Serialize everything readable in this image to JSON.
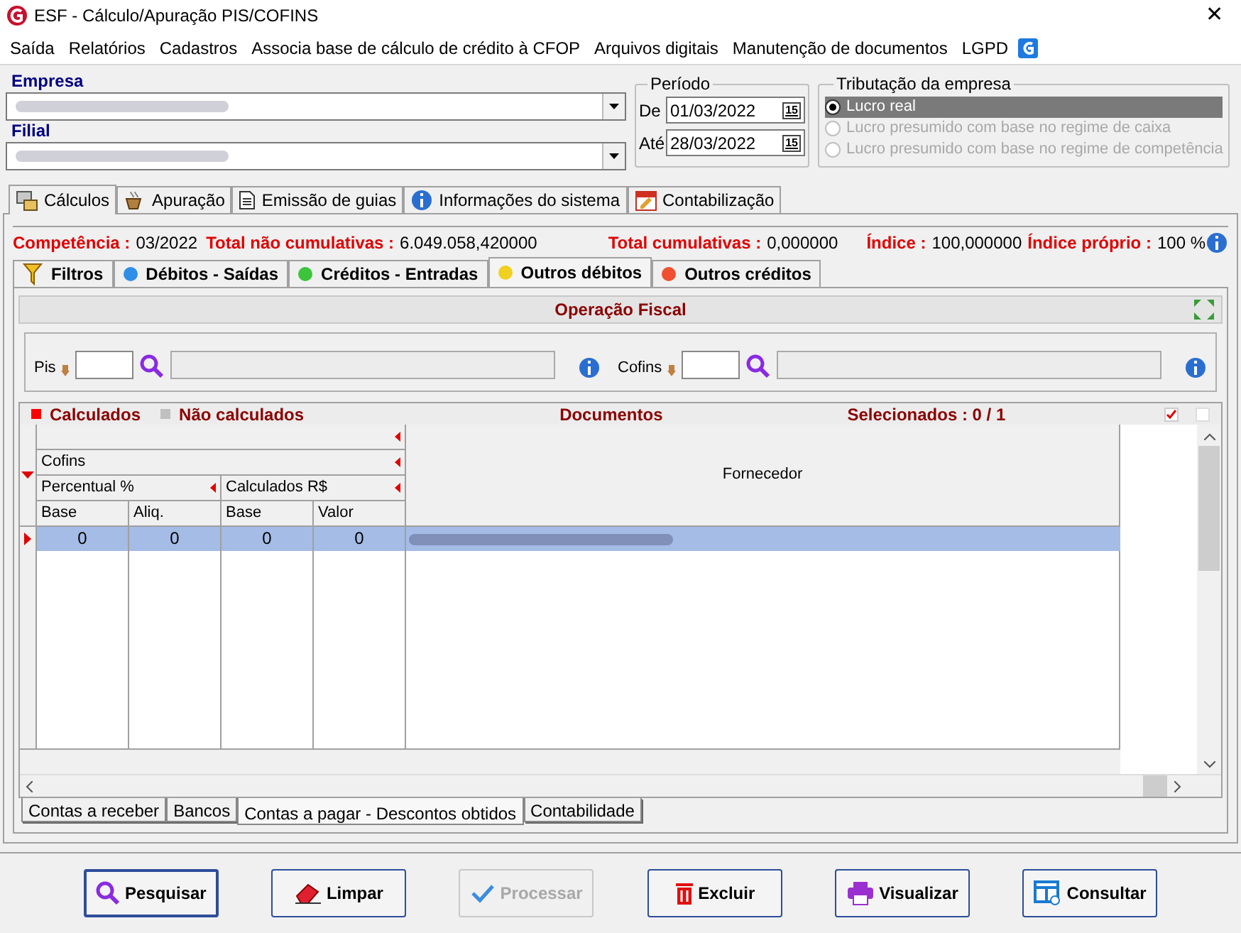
{
  "window": {
    "title": "ESF - Cálculo/Apuração PIS/COFINS",
    "close": "✕"
  },
  "menu": [
    {
      "label": "Saída"
    },
    {
      "label": "Relatórios"
    },
    {
      "label": "Cadastros"
    },
    {
      "label": "Associa base de cálculo de crédito à CFOP"
    },
    {
      "label": "Arquivos digitais"
    },
    {
      "label": "Manutenção de documentos"
    },
    {
      "label": "LGPD"
    }
  ],
  "empresa": {
    "label": "Empresa"
  },
  "filial": {
    "label": "Filial"
  },
  "periodo": {
    "title": "Período",
    "fields": [
      {
        "label": "De",
        "value": "01/03/2022",
        "calendar": "15"
      },
      {
        "label": "Até",
        "value": "28/03/2022",
        "calendar": "15"
      }
    ]
  },
  "tributacao": {
    "title": "Tributação da empresa",
    "options": [
      {
        "label": "Lucro real",
        "selected": true,
        "disabled": false
      },
      {
        "label": "Lucro presumido com base no regime de caixa",
        "selected": false,
        "disabled": true
      },
      {
        "label": "Lucro presumido com base no regime de competência",
        "selected": false,
        "disabled": true
      }
    ]
  },
  "main_tabs": [
    {
      "label": "Cálculos",
      "selected": true,
      "kind": "calc"
    },
    {
      "label": "Apuração",
      "selected": false,
      "kind": "coffee"
    },
    {
      "label": "Emissão de guias",
      "selected": false,
      "kind": "doc"
    },
    {
      "label": "Informações do sistema",
      "selected": false,
      "kind": "info"
    },
    {
      "label": "Contabilização",
      "selected": false,
      "kind": "calendar"
    }
  ],
  "summary": [
    {
      "label": "Competência :",
      "value": "03/2022"
    },
    {
      "label": "Total não cumulativas :",
      "value": "6.049.058,420000"
    },
    {
      "label": "Total cumulativas :",
      "value": "0,000000"
    },
    {
      "label": "Índice :",
      "value": "100,000000"
    },
    {
      "label": "Índice próprio :",
      "value": "100 %"
    }
  ],
  "sub_tabs": [
    {
      "label": "Filtros",
      "selected": false,
      "kind": "filter"
    },
    {
      "label": "Débitos - Saídas",
      "selected": false,
      "kind": "dot",
      "color": "#2f8fe8"
    },
    {
      "label": "Créditos - Entradas",
      "selected": false,
      "kind": "dot",
      "color": "#3cc43c"
    },
    {
      "label": "Outros débitos",
      "selected": true,
      "kind": "dot",
      "color": "#f0d020"
    },
    {
      "label": "Outros créditos",
      "selected": false,
      "kind": "dot",
      "color": "#f05030"
    }
  ],
  "operacao": {
    "title": "Operação Fiscal",
    "fields": [
      {
        "label": "Pis"
      },
      {
        "label": "Cofins"
      }
    ]
  },
  "grid": {
    "legend": [
      {
        "label": "Calculados",
        "color": "#ff0000"
      },
      {
        "label": "Não calculados",
        "color": "#c0c0c0"
      }
    ],
    "title": "Documentos",
    "selected_text": "Selecionados : 0 / 1",
    "header_rows": [
      [
        "Cofins"
      ],
      [
        "Percentual %",
        "Calculados R$"
      ]
    ],
    "columns": [
      "Base",
      "Aliq.",
      "Base",
      "Valor"
    ],
    "last_column": "Fornecedor",
    "rows": [
      {
        "cells": [
          "0",
          "0",
          "0",
          "0"
        ],
        "selected": true
      }
    ]
  },
  "bottom_tabs": [
    {
      "label": "Contas a receber",
      "selected": false
    },
    {
      "label": "Bancos",
      "selected": false
    },
    {
      "label": "Contas a pagar - Descontos obtidos",
      "selected": true
    },
    {
      "label": "Contabilidade",
      "selected": false
    }
  ],
  "buttons": [
    {
      "label": "Pesquisar",
      "disabled": false,
      "kind": "search"
    },
    {
      "label": "Limpar",
      "disabled": false,
      "kind": "eraser"
    },
    {
      "label": "Processar",
      "disabled": true,
      "kind": "check"
    },
    {
      "label": "Excluir",
      "disabled": false,
      "kind": "trash"
    },
    {
      "label": "Visualizar",
      "disabled": false,
      "kind": "print"
    },
    {
      "label": "Consultar",
      "disabled": false,
      "kind": "table"
    }
  ]
}
